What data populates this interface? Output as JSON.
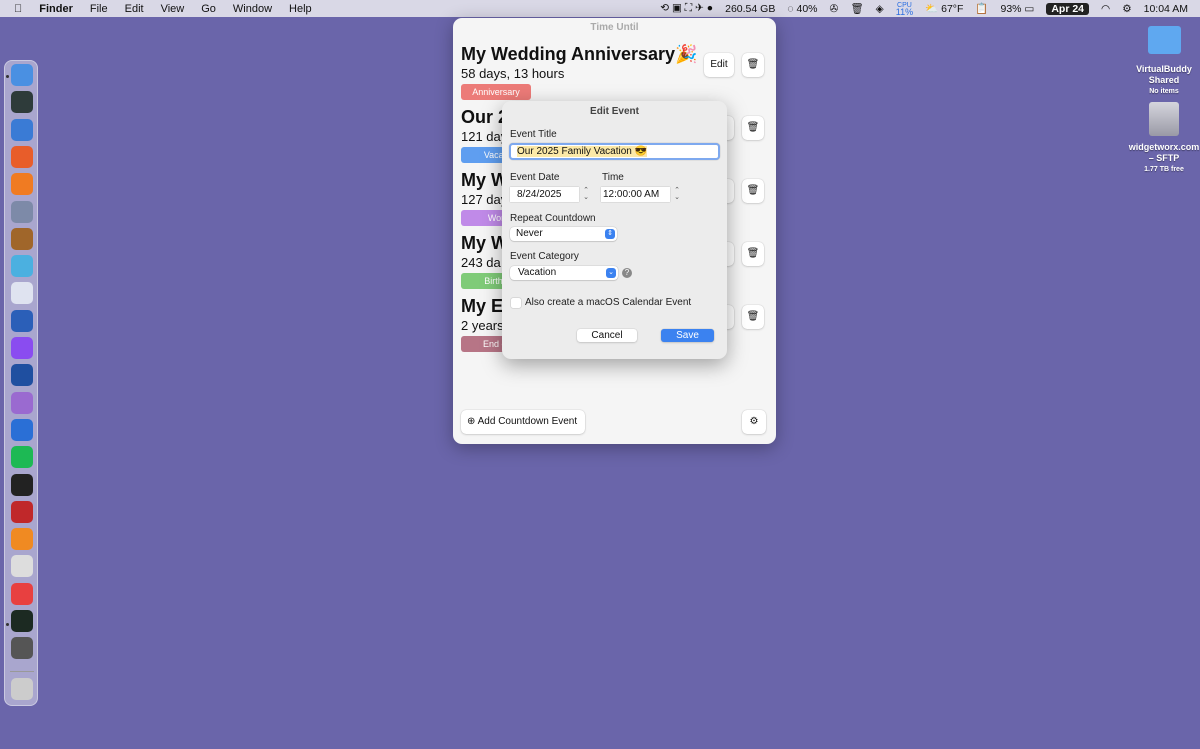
{
  "menubar": {
    "app": "Finder",
    "menus": [
      "File",
      "Edit",
      "View",
      "Go",
      "Window",
      "Help"
    ],
    "disk": "260.54 GB",
    "battery_ring": "40%",
    "cpu_label": "CPU",
    "cpu_value": "11%",
    "weather": "67°F",
    "battery": "93%",
    "date": "Apr 24",
    "time": "10:04 AM"
  },
  "window": {
    "title": "Time Until",
    "events": [
      {
        "title": "My Wedding Anniversary🎉",
        "countdown": "58 days, 13 hours",
        "category": "Anniversary",
        "color": "#ec7b78"
      },
      {
        "title": "Our 2",
        "countdown": "121 day",
        "category": "Vacati",
        "color": "#5f9ef0"
      },
      {
        "title": "My W",
        "countdown": "127 day",
        "category": "Wor",
        "color": "#c08ae8"
      },
      {
        "title": "My W",
        "countdown": "243 da",
        "category": "Birtho",
        "color": "#7fcb78"
      },
      {
        "title": "My Ea",
        "countdown": "2 years",
        "category": "End of",
        "color": "#b77586"
      }
    ],
    "edit_label": "Edit",
    "add_label": "Add Countdown Event"
  },
  "sheet": {
    "title": "Edit Event",
    "event_title_label": "Event Title",
    "event_title_value": "Our 2025 Family Vacation 😎",
    "date_label": "Event Date",
    "date_value": "8/24/2025",
    "time_label": "Time",
    "time_value": "12:00:00 AM",
    "repeat_label": "Repeat Countdown",
    "repeat_value": "Never",
    "category_label": "Event Category",
    "category_value": "Vacation",
    "calendar_checkbox": "Also create a macOS Calendar Event",
    "calendar_checked": false,
    "cancel": "Cancel",
    "save": "Save"
  },
  "desktop": [
    {
      "name": "VirtualBuddy Shared",
      "info": "No items"
    },
    {
      "name": "widgetworx.com – SFTP",
      "info": "1.77 TB free"
    }
  ]
}
